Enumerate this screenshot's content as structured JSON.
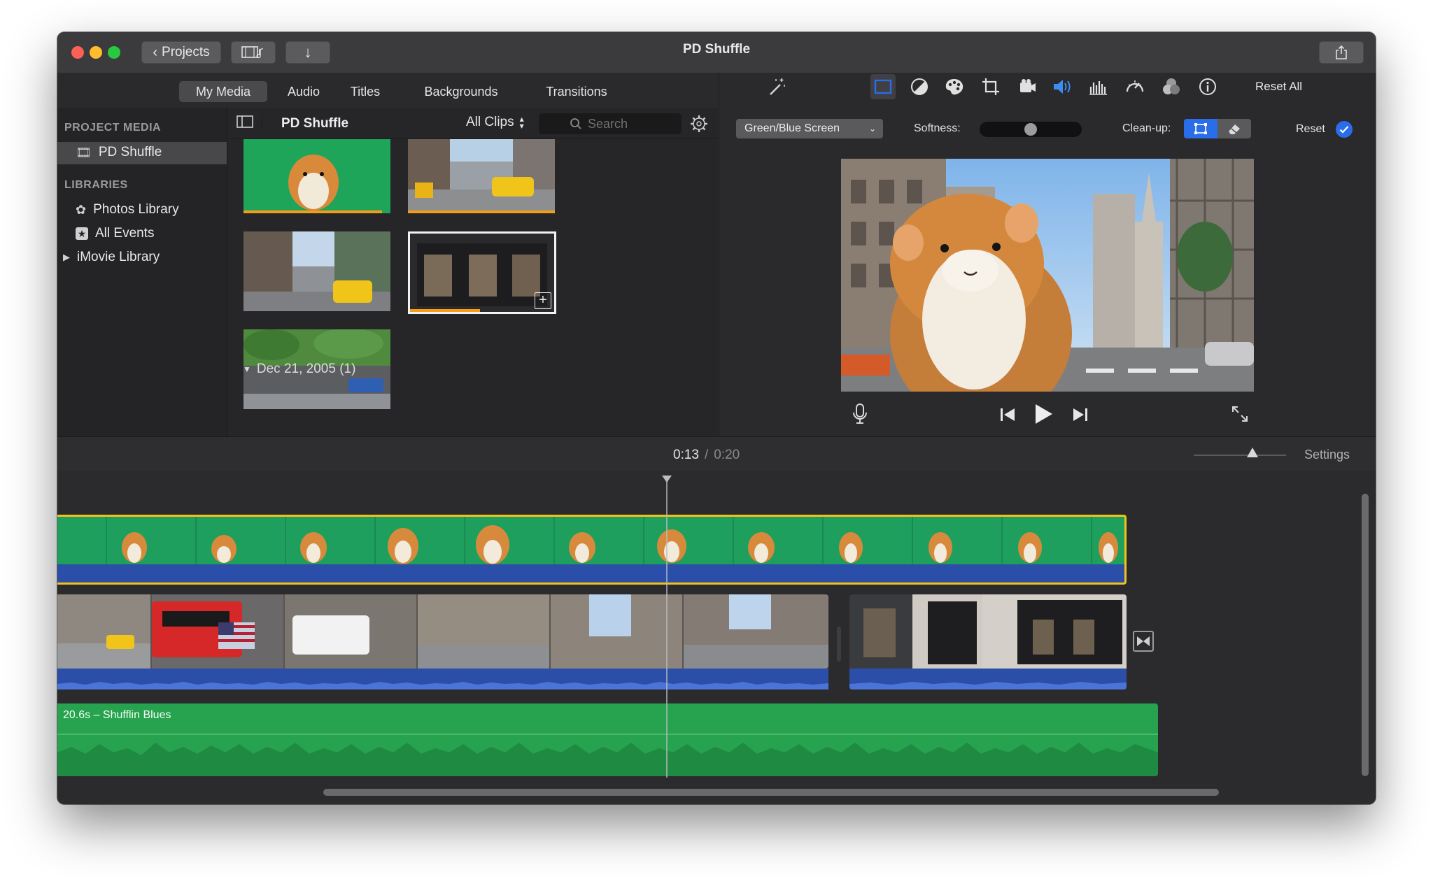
{
  "window": {
    "title": "PD Shuffle"
  },
  "toolbar": {
    "projects_label": "Projects"
  },
  "tabs": [
    {
      "label": "My Media",
      "active": true
    },
    {
      "label": "Audio",
      "active": false
    },
    {
      "label": "Titles",
      "active": false
    },
    {
      "label": "Backgrounds",
      "active": false
    },
    {
      "label": "Transitions",
      "active": false
    }
  ],
  "sidebar": {
    "project_media_header": "PROJECT MEDIA",
    "project_item": "PD Shuffle",
    "libraries_header": "LIBRARIES",
    "libraries": [
      {
        "label": "Photos Library",
        "icon": "photos-icon"
      },
      {
        "label": "All Events",
        "icon": "star-icon"
      },
      {
        "label": "iMovie Library",
        "icon": "disclosure-triangle-icon"
      }
    ]
  },
  "browser": {
    "title": "PD Shuffle",
    "filter": "All Clips",
    "search_placeholder": "Search",
    "date_group": "Dec 21, 2005  (1)"
  },
  "adjust": {
    "reset_all": "Reset All",
    "effect": "Green/Blue Screen",
    "softness_label": "Softness:",
    "softness_value": 0.5,
    "cleanup_label": "Clean-up:",
    "reset": "Reset"
  },
  "playback": {
    "current": "0:13",
    "separator": "/",
    "total": "0:20"
  },
  "timeline": {
    "settings": "Settings",
    "music_label": "20.6s – Shufflin Blues"
  },
  "colors": {
    "accent_blue": "#2a6de8",
    "selection_yellow": "#f2c21a",
    "greenscreen": "#25a35a",
    "audio_blue": "#2b4ea8",
    "music_green": "#27a24f",
    "progress_orange": "#f59d1a"
  }
}
